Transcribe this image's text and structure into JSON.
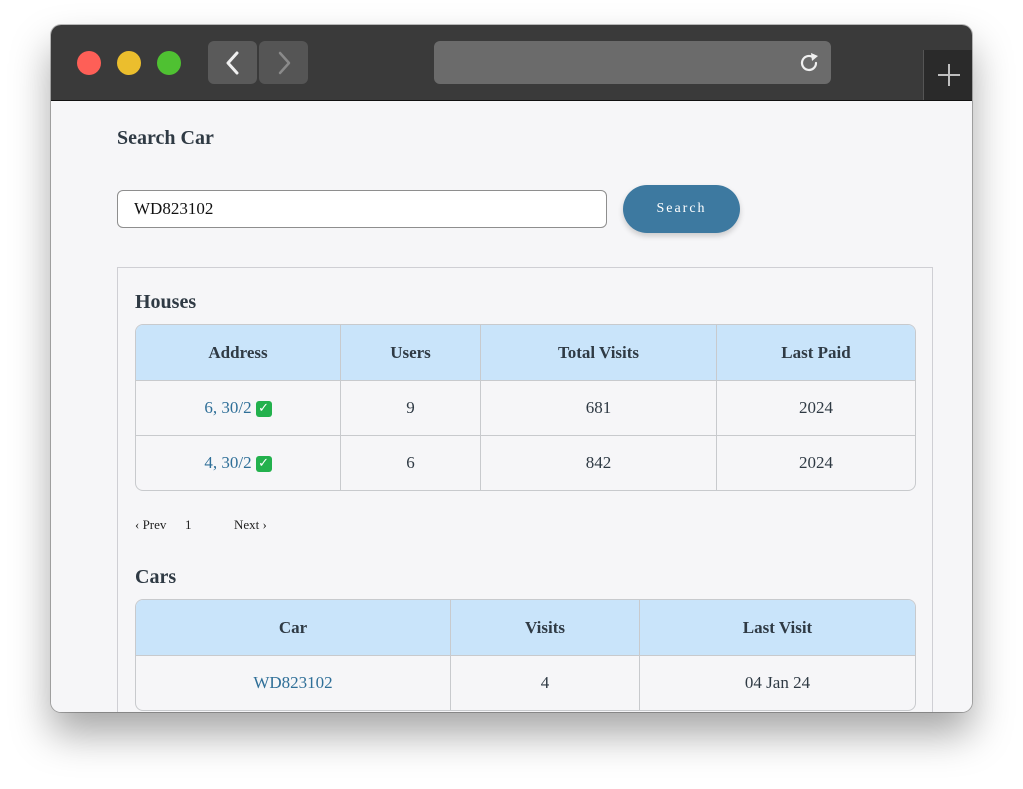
{
  "search": {
    "title": "Search Car",
    "value": "WD823102",
    "button_label": "Search"
  },
  "houses": {
    "title": "Houses",
    "headers": [
      "Address",
      "Users",
      "Total Visits",
      "Last Paid"
    ],
    "rows": [
      {
        "address": "6, 30/2",
        "verified": "✓",
        "users": "9",
        "total_visits": "681",
        "last_paid": "2024"
      },
      {
        "address": "4, 30/2",
        "verified": "✓",
        "users": "6",
        "total_visits": "842",
        "last_paid": "2024"
      }
    ]
  },
  "pagination": {
    "prev": "‹ Prev",
    "page": "1",
    "next": "Next ›"
  },
  "cars": {
    "title": "Cars",
    "headers": [
      "Car",
      "Visits",
      "Last Visit"
    ],
    "rows": [
      {
        "car": "WD823102",
        "visits": "4",
        "last_visit": "04 Jan 24"
      }
    ]
  },
  "colors": {
    "accent": "#3d79a0",
    "table_header": "#c9e4fa",
    "link": "#2f6f98"
  }
}
